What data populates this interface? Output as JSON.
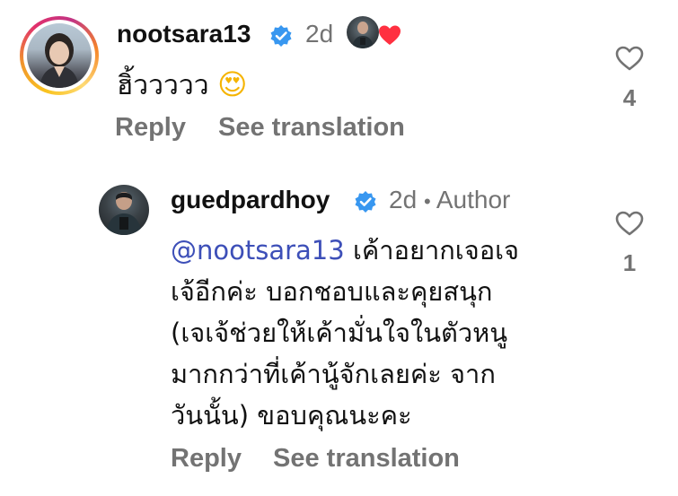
{
  "comment": {
    "username": "nootsara13",
    "verified_icon": "verified-badge-icon",
    "timestamp": "2d",
    "liked_by_author_icon": "heart-icon",
    "text_prefix": "ฮิ้ววววว",
    "emoji": "😍",
    "like_count": "4",
    "reply_label": "Reply",
    "translate_label": "See translation"
  },
  "reply": {
    "username": "guedpardhoy",
    "verified_icon": "verified-badge-icon",
    "timestamp": "2d",
    "separator": "•",
    "author_label": "Author",
    "mention": "@nootsara13",
    "lines": [
      "เค้าอยากเจอเจ",
      "เจ้อีกค่ะ บอกชอบและคุยสนุก",
      "(เจเจ้ช่วยให้เค้ามั่นใจในตัวหนู",
      "มากกว่าที่เค้านู้จักเลยค่ะ จาก",
      "วันนั้น) ขอบคุณนะคะ"
    ],
    "like_count": "1",
    "reply_label": "Reply",
    "translate_label": "See translation"
  },
  "colors": {
    "verified": "#3897f0",
    "heart": "#ff3040",
    "secondary_text": "#737373",
    "mention": "#3d4fb8"
  }
}
